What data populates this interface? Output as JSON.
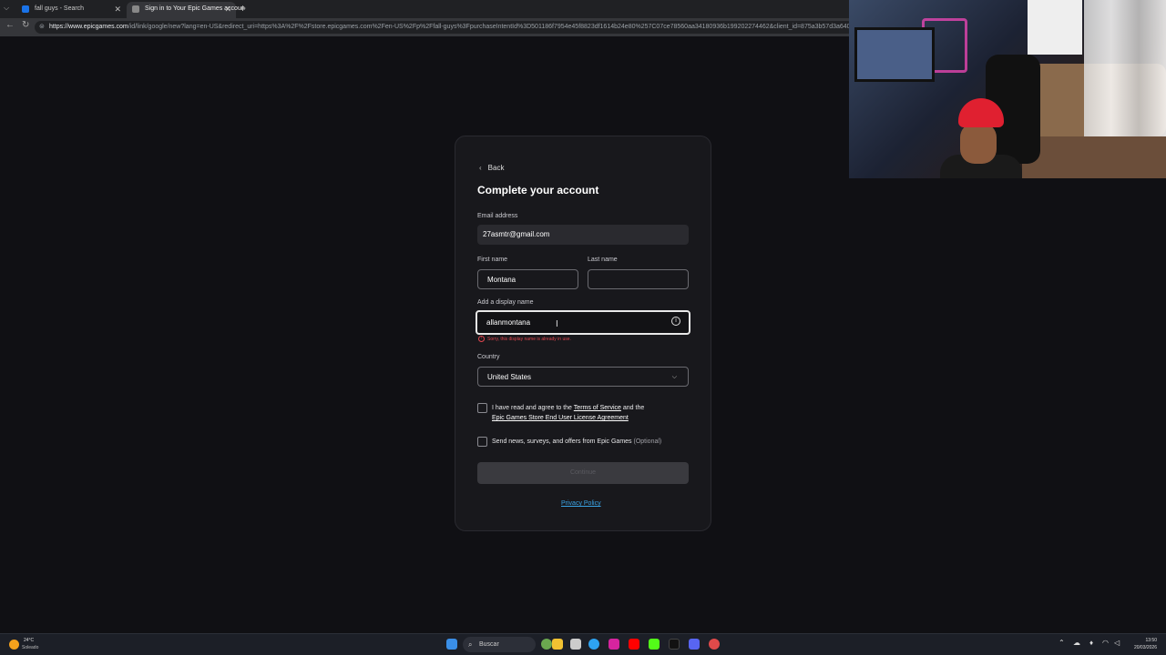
{
  "browser": {
    "tabs": [
      {
        "label": "fall guys - Search"
      },
      {
        "label": "Sign in to Your Epic Games accoun"
      }
    ],
    "url_domain": "https://www.epicgames.com",
    "url_rest": "/id/link/google/new?lang=en-US&redirect_uri=https%3A%2F%2Fstore.epicgames.com%2Fen-US%2Fp%2Ffall-guys%3FpurchaseIntentId%3D501186f7954e45f8823df1614b24e80%257C07ce78560aa34180936b199202274462&client_id=875a3b57d3a640a"
  },
  "form": {
    "back_label": "Back",
    "title": "Complete your account",
    "email_label": "Email address",
    "email_value": "27asmtr@gmail.com",
    "first_name_label": "First name",
    "first_name_value": "Montana",
    "last_name_label": "Last name",
    "last_name_value": "",
    "display_name_label": "Add a display name",
    "display_name_value": "allanmontana",
    "display_name_error": "Sorry, this display name is already in use.",
    "country_label": "Country",
    "country_value": "United States",
    "terms_prefix": "I have read and agree to the",
    "terms_link": "Terms of Service",
    "terms_and": "and the",
    "eula_link": "Epic Games Store End User License Agreement",
    "news_text": "Send news, surveys, and offers from Epic Games",
    "news_optional": "(Optional)",
    "continue_label": "Continue",
    "privacy_label": "Privacy Policy"
  },
  "taskbar": {
    "temperature": "24°C",
    "condition": "Soleado",
    "search_label": "Buscar",
    "time": "13:50",
    "date": "20/03/2026"
  },
  "colors": {
    "background": "#101014",
    "card": "#18181c",
    "error": "#e0464f",
    "link": "#3aa4e6"
  }
}
